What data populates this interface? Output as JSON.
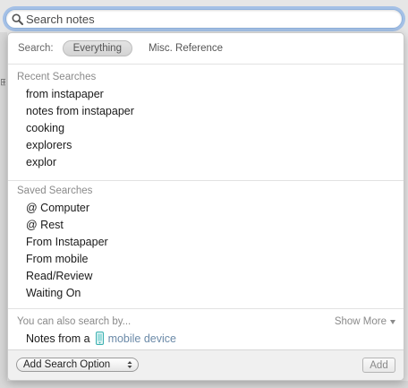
{
  "search": {
    "placeholder": "Search notes",
    "value": ""
  },
  "scope": {
    "label": "Search:",
    "options": [
      {
        "label": "Everything",
        "selected": true
      },
      {
        "label": "Misc. Reference",
        "selected": false
      }
    ]
  },
  "recent": {
    "header": "Recent Searches",
    "items": [
      "from instapaper",
      "notes from instapaper",
      "cooking",
      "explorers",
      "explor"
    ]
  },
  "saved": {
    "header": "Saved Searches",
    "items": [
      "@ Computer",
      "@ Rest",
      "From Instapaper",
      "From mobile",
      "Read/Review",
      "Waiting On"
    ]
  },
  "also": {
    "header": "You can also search by...",
    "show_more": "Show More",
    "prefix": "Notes from a",
    "device_link": "mobile device",
    "device_icon": "mobile-phone-icon"
  },
  "footer": {
    "add_option_label": "Add Search Option",
    "add_button_label": "Add"
  },
  "colors": {
    "focus_ring": "#6ea0e6",
    "link_blue": "#6b8aa8",
    "device_teal": "#3ab0b0"
  }
}
